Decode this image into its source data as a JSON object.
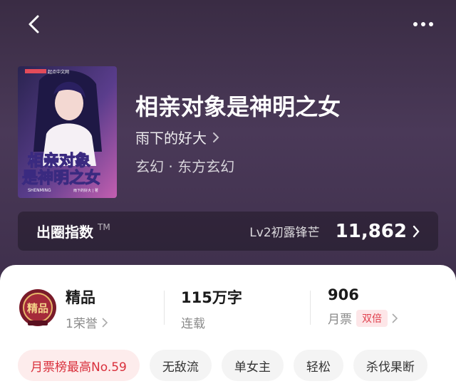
{
  "book": {
    "title": "相亲对象是神明之女",
    "author": "雨下的好大",
    "genre": "玄幻 · 东方玄幻"
  },
  "cover": {
    "title_line1": "相亲对象",
    "title_line2": "是神明之女",
    "pinyin": "SHENMING",
    "author_tag": "雨下的好大 | 著",
    "publisher_tag": "起点中文网"
  },
  "index": {
    "label": "出圈指数",
    "tm": "TM",
    "level": "Lv2初露锋芒",
    "value": "11,862"
  },
  "stats": {
    "quality": {
      "title": "精品",
      "sub": "1荣誉",
      "badge_text": "精品"
    },
    "words": {
      "title": "115万字",
      "sub": "连载"
    },
    "tickets": {
      "title": "906",
      "sub": "月票",
      "badge": "双倍"
    }
  },
  "tags": [
    "月票榜最高No.59",
    "无敌流",
    "单女主",
    "轻松",
    "杀伐果断"
  ],
  "colors": {
    "hero_bg": "#3e2f4b",
    "accent_red": "#d9303c",
    "badge_bg": "#fde6e8"
  },
  "icons": {
    "back": "chevron-left-icon",
    "more": "more-dots-icon",
    "author_chevron": "chevron-right-icon"
  }
}
